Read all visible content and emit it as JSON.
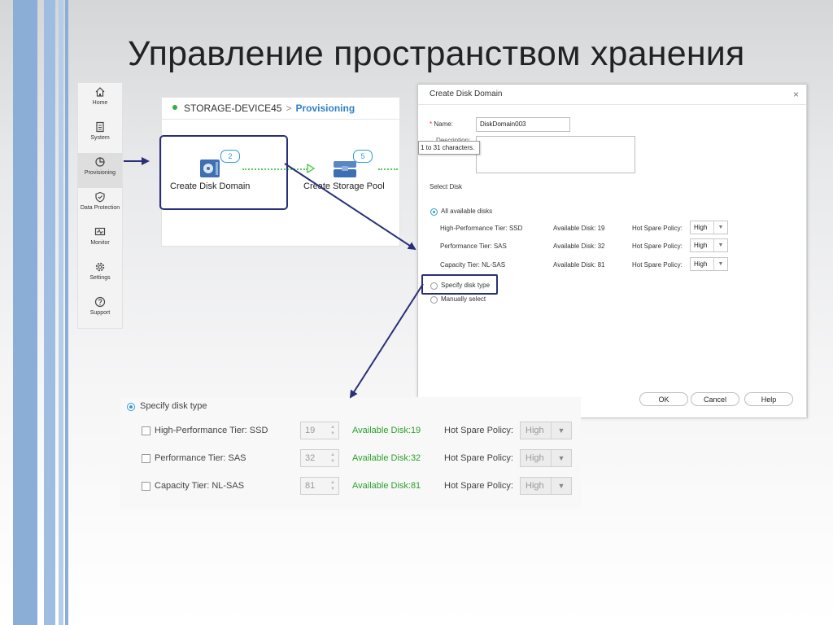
{
  "slide_title": "Управление пространством хранения",
  "nav": {
    "items": [
      {
        "label": "Home",
        "icon": "home-icon"
      },
      {
        "label": "System",
        "icon": "system-icon"
      },
      {
        "label": "Provisioning",
        "icon": "provisioning-icon"
      },
      {
        "label": "Data Protection",
        "icon": "shield-icon"
      },
      {
        "label": "Monitor",
        "icon": "monitor-icon"
      },
      {
        "label": "Settings",
        "icon": "gear-icon"
      },
      {
        "label": "Support",
        "icon": "help-icon"
      }
    ],
    "active": "Provisioning"
  },
  "storage": {
    "device": "STORAGE-DEVICE45",
    "breadcrumb_sep": ">",
    "section": "Provisioning",
    "steps": [
      {
        "label": "Create Disk Domain",
        "badge": "2"
      },
      {
        "label": "Create Storage Pool",
        "badge": "5"
      }
    ]
  },
  "dialog": {
    "title": "Create Disk Domain",
    "close": "×",
    "name_required": "*",
    "name_label": "Name:",
    "name_value": "DiskDomain003",
    "description_label": "Description:",
    "description_tooltip": "1 to 31 characters.",
    "select_disk_label": "Select Disk",
    "all_available": "All available disks",
    "tiers": [
      {
        "tier": "High-Performance Tier:",
        "type": "SSD",
        "available_label": "Available Disk:",
        "available": "19",
        "policy_label": "Hot Spare Policy:",
        "policy": "High"
      },
      {
        "tier": "Performance Tier:",
        "type": "SAS",
        "available_label": "Available Disk:",
        "available": "32",
        "policy_label": "Hot Spare Policy:",
        "policy": "High"
      },
      {
        "tier": "Capacity Tier:",
        "type": "NL-SAS",
        "available_label": "Available Disk:",
        "available": "81",
        "policy_label": "Hot Spare Policy:",
        "policy": "High"
      }
    ],
    "specify_disk_type": "Specify disk type",
    "manually_select": "Manually select",
    "buttons": {
      "ok": "OK",
      "cancel": "Cancel",
      "help": "Help"
    }
  },
  "zoom": {
    "specify_disk_type": "Specify disk type",
    "rows": [
      {
        "tier": "High-Performance Tier:",
        "type": "SSD",
        "count": "19",
        "available": "Available Disk:19",
        "policy_label": "Hot Spare Policy:",
        "policy": "High"
      },
      {
        "tier": "Performance Tier:",
        "type": "SAS",
        "count": "32",
        "available": "Available Disk:32",
        "policy_label": "Hot Spare Policy:",
        "policy": "High"
      },
      {
        "tier": "Capacity Tier:",
        "type": "NL-SAS",
        "count": "81",
        "available": "Available Disk:81",
        "policy_label": "Hot Spare Policy:",
        "policy": "High"
      }
    ]
  },
  "colors": {
    "accent_blue": "#2f9bd6",
    "highlight_navy": "#2a2f7a",
    "green": "#2aa02a",
    "required_red": "#d9302c"
  }
}
